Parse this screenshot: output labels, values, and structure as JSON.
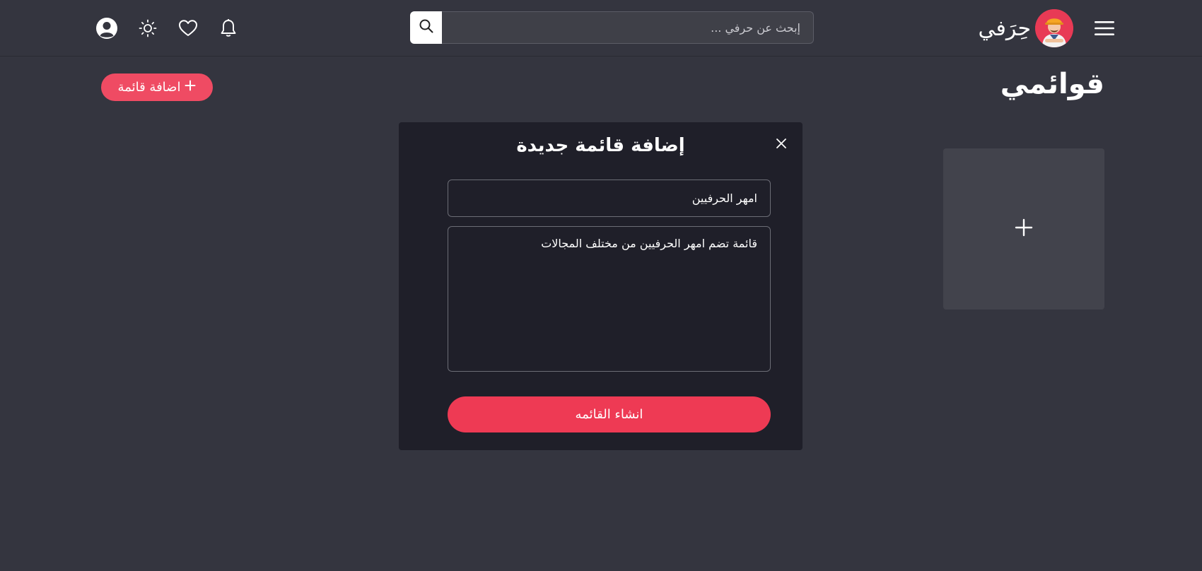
{
  "header": {
    "brand_name": "حِرَفي",
    "search": {
      "placeholder": "إبحث عن حرفي ..."
    }
  },
  "page": {
    "title": "قوائمي",
    "add_list_label": "اضافة قائمة",
    "add_list_icon": "plus-icon"
  },
  "modal": {
    "title": "إضافة قائمة جديدة",
    "name_value": "امهر الحرفيين",
    "description_value": "قائمة تضم امهر الحرفيين من مختلف المجالات",
    "submit_label": "انشاء القائمه"
  },
  "colors": {
    "background": "#34353f",
    "modal": "#1f1f29",
    "accent": "#ee3a54",
    "card": "#42434c"
  }
}
